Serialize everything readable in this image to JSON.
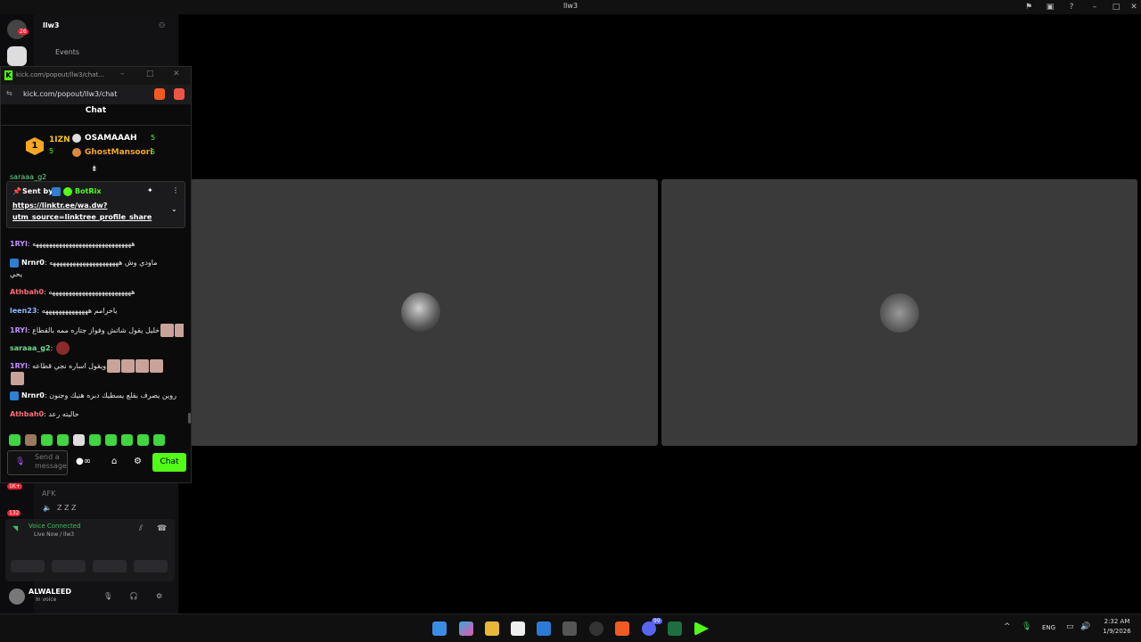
{
  "window": {
    "title": "llw3"
  },
  "discord": {
    "server_name": "llw3",
    "rail_badge": "26",
    "events_label": "Events",
    "afk_label": "AFK",
    "afk_badge": "1K+",
    "afk_badge2": "132",
    "afk_member": "Z Z Z",
    "voice_status": "Voice Connected",
    "voice_channel": "Live Now / llw3",
    "user_name": "ALWALEED",
    "user_status": "In voice"
  },
  "popout": {
    "window_title": "kick.com/popout/llw3/chat...",
    "url": "kick.com/popout/llw3/chat",
    "chat_header": "Chat",
    "gifters": {
      "rank": "1",
      "top_name": "1IZN",
      "top_count": "5",
      "second_name": "OSAMAAAH",
      "second_count": "5",
      "third_name": "GhostMansoori",
      "third_count": "5"
    },
    "partial_msg_user": "saraaa_g2",
    "pinned": {
      "sent_by_label": "Sent by",
      "bot_name": "BotRix",
      "link_line1": "https://linktr.ee/wa.dw?",
      "link_line2": "utm_source=linktree_profile_share"
    },
    "messages": [
      {
        "user": "1RYl",
        "color": "#c48bff",
        "text": "ههههههههههههههههههههههههههههههه"
      },
      {
        "user": "Nrnr0",
        "color": "#ffffff",
        "text": "ماودي وش هههههههههههههههههههههه"
      },
      {
        "user": "",
        "color": "#ffffff",
        "text": "يحي"
      },
      {
        "user": "Athbah0",
        "color": "#ff6b7a",
        "text": "هههههههههههههههههههههههههه"
      },
      {
        "user": "leen23",
        "color": "#8fb8ff",
        "text": "ياحرامم ههههههههههههههه"
      },
      {
        "user": "1RYl",
        "color": "#c48bff",
        "text": "خليل يقول شاتش وفواز جتاره ممه بالقطاع"
      },
      {
        "user": "saraaa_g2",
        "color": "#6fdc8c",
        "text": ""
      },
      {
        "user": "1RYl",
        "color": "#c48bff",
        "text": "ويقول اساره نجي قطاعه"
      },
      {
        "user": "Nrnr0",
        "color": "#ffffff",
        "text": "روين يصرف بقلع يسطيك دبره هنيك وجنون"
      },
      {
        "user": "Athbah0",
        "color": "#ff6b7a",
        "text": "حاليته رعد"
      }
    ],
    "input_placeholder": "Send a message",
    "chat_button": "Chat"
  },
  "taskbar": {
    "lang": "ENG",
    "time": "2:32 AM",
    "date": "1/9/2026",
    "discord_badge": "99"
  }
}
